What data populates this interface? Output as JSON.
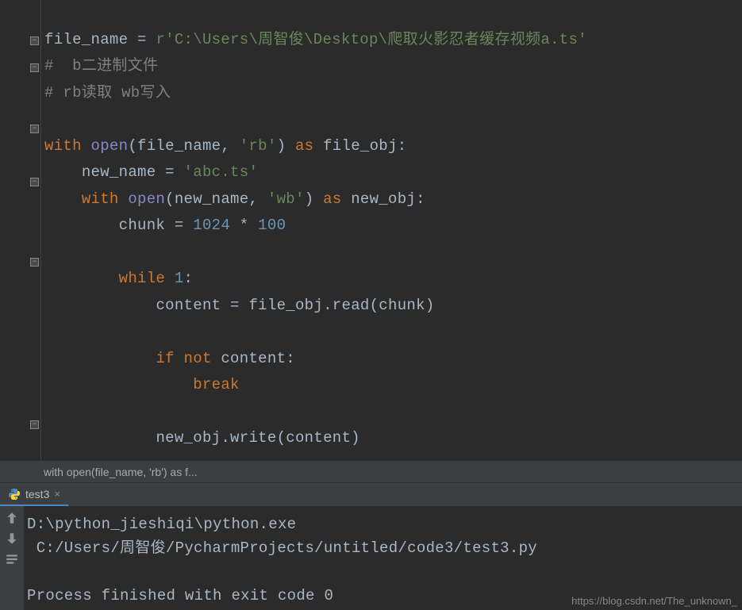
{
  "code": {
    "file_name_var": "file_name",
    "eq": " = ",
    "r_prefix": "r",
    "file_path": "'C:\\Users\\周智俊\\Desktop\\爬取火影忍者缓存视频a.ts'",
    "comment1_hash": "#  ",
    "comment1_b": "b",
    "comment1_rest": "二进制文件",
    "comment2": "# rb读取 wb写入",
    "with1": "with",
    "open1": "open",
    "rb": "'rb'",
    "as1": "as",
    "file_obj": "file_obj",
    "new_name_var": "new_name",
    "new_name_val": "'abc.ts'",
    "with2": "with",
    "open2": "open",
    "wb": "'wb'",
    "as2": "as",
    "new_obj": "new_obj",
    "chunk": "chunk",
    "num1024": "1024",
    "star": " * ",
    "num100": "100",
    "while": "while",
    "one": "1",
    "content": "content",
    "read": ".read(chunk)",
    "if": "if",
    "not": "not",
    "break": "break",
    "write": ".write(content)"
  },
  "breadcrumb": "with open(file_name, 'rb') as f...",
  "tab": {
    "name": "test3",
    "close": "×"
  },
  "console": {
    "line1a": "D:\\python_jieshiqi\\python.exe",
    "line1b": " C:/Users/周智俊/PycharmProjects/untitled/code3/test3.py",
    "line2": "Process finished with exit code 0"
  },
  "watermark": "https://blog.csdn.net/The_unknown_"
}
